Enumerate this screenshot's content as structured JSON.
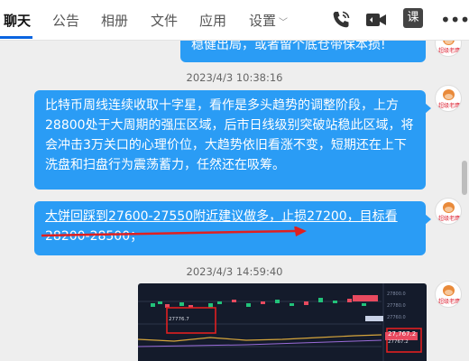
{
  "nav": {
    "tabs": [
      {
        "label": "聊天",
        "active": true
      },
      {
        "label": "公告"
      },
      {
        "label": "相册"
      },
      {
        "label": "文件"
      },
      {
        "label": "应用"
      },
      {
        "label": "设置"
      }
    ],
    "icons": [
      "phone-icon",
      "video-call-icon",
      "course-icon",
      "more-icon"
    ],
    "course_label": "课",
    "more_glyph": "•••"
  },
  "messages": [
    {
      "text": "稳健出局，或者留个底仓带保本损!"
    },
    {
      "timestamp": "2023/4/3 10:38:16"
    },
    {
      "text": "比特币周线连续收取十字星，看作是多头趋势的调整阶段，上方28800处于大周期的强压区域，后市日线级别突破站稳此区域，将会冲击3万关口的心理价位，大趋势依旧看涨不变，短期还在上下洗盘和扫盘行为震荡蓄力，任然还在吸筹。"
    },
    {
      "text_line1": "大饼回踩到27600-27550附近建议做多，止损27200，目标看",
      "text_line2": "28200-28500；"
    },
    {
      "timestamp": "2023/4/3 14:59:40"
    },
    {
      "type": "chart-screenshot",
      "labels": [
        "27776.7",
        "27767.2",
        "27,767.2",
        "27800.0",
        "27780.0",
        "27760.0"
      ]
    }
  ],
  "avatar_label": "超级老鹰",
  "colors": {
    "bubble": "#2a9cf5",
    "annotation": "#e02020",
    "accent": "#0a64e0",
    "chart_bg": "#141b2b"
  }
}
